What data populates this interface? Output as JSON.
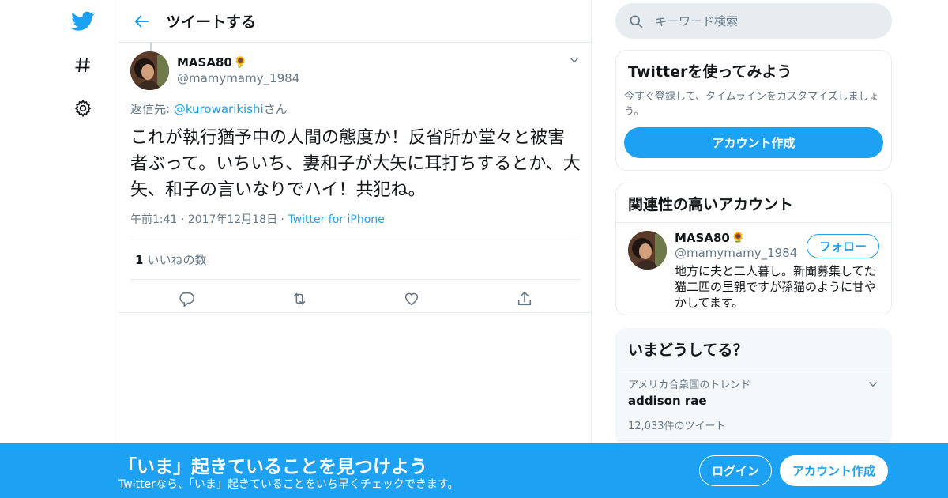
{
  "header": {
    "title": "ツイートする"
  },
  "tweet": {
    "author": {
      "name": "MASA80",
      "emoji": "🌻",
      "handle": "@mamymamy_1984"
    },
    "reply_prefix": "返信先: ",
    "reply_to": "@kurowarikishi",
    "reply_suffix": "さん",
    "text": "これが執行猶予中の人間の態度か！反省所か堂々と被害者ぶって。いちいち、妻和子が大矢に耳打ちするとか、大矢、和子の言いなりでハイ！共犯ね。",
    "time": "午前1:41",
    "date": "2017年12月18日",
    "source": "Twitter for iPhone",
    "likes_count": "1",
    "likes_label": "いいねの数"
  },
  "search": {
    "placeholder": "キーワード検索"
  },
  "signup_card": {
    "title": "Twitterを使ってみよう",
    "desc": "今すぐ登録して、タイムラインをカスタマイズしましょう。",
    "button": "アカウント作成"
  },
  "related_card": {
    "title": "関連性の高いアカウント",
    "account": {
      "name": "MASA80",
      "emoji": "🌻",
      "handle": "@mamymamy_1984",
      "bio": "地方に夫と二人暮し。新聞募集してた猫二匹の里親ですが孫猫のように甘やかしてます。",
      "follow_label": "フォロー"
    }
  },
  "trends_card": {
    "title": "いまどうしてる？",
    "items": [
      {
        "context": "アメリカ合衆国のトレンド",
        "name": "addison rae",
        "count": "12,033件のツイート"
      }
    ]
  },
  "banner": {
    "title": "「いま」起きていることを見つけよう",
    "subtitle": "Twitterなら、「いま」起きていることをいち早くチェックできます。",
    "login": "ログイン",
    "signup": "アカウント作成"
  },
  "colors": {
    "accent": "#1da1f2",
    "text": "#14171a",
    "secondary": "#657786",
    "border": "#e6ecf0"
  }
}
